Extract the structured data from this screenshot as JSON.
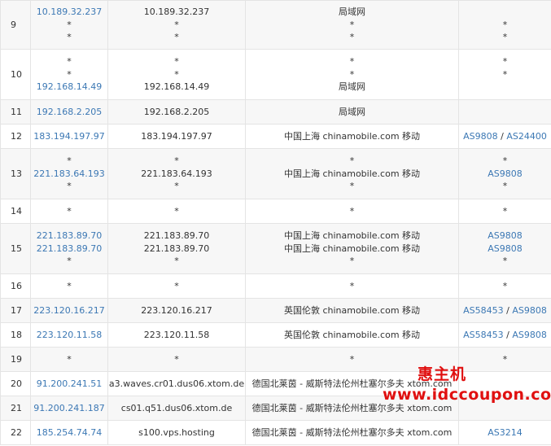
{
  "rows": [
    {
      "hop": "9",
      "h": 60,
      "ip": [
        {
          "t": "10.189.32.237",
          "link": true
        },
        {
          "t": "*"
        },
        {
          "t": "*"
        }
      ],
      "host": [
        "10.189.32.237",
        "*",
        "*"
      ],
      "loc": [
        "局域网",
        "*",
        "*"
      ],
      "as": [
        [],
        [
          "*"
        ],
        [
          "*"
        ]
      ]
    },
    {
      "hop": "10",
      "h": 62,
      "ip": [
        {
          "t": "*"
        },
        {
          "t": "*"
        },
        {
          "t": "192.168.14.49",
          "link": true
        }
      ],
      "host": [
        "*",
        "*",
        "192.168.14.49"
      ],
      "loc": [
        "*",
        "*",
        "局域网"
      ],
      "as": [
        [
          "*"
        ],
        [
          "*"
        ],
        []
      ]
    },
    {
      "hop": "11",
      "h": 30,
      "ip": [
        {
          "t": "192.168.2.205",
          "link": true
        }
      ],
      "host": [
        "192.168.2.205"
      ],
      "loc": [
        "局域网"
      ],
      "as": [
        []
      ]
    },
    {
      "hop": "12",
      "h": 30,
      "ip": [
        {
          "t": "183.194.197.97",
          "link": true
        }
      ],
      "host": [
        "183.194.197.97"
      ],
      "loc": [
        "中国上海 chinamobile.com 移动"
      ],
      "as": [
        [
          "AS9808",
          "AS24400"
        ]
      ]
    },
    {
      "hop": "13",
      "h": 62,
      "ip": [
        {
          "t": "*"
        },
        {
          "t": "221.183.64.193",
          "link": true
        },
        {
          "t": "*"
        }
      ],
      "host": [
        "*",
        "221.183.64.193",
        "*"
      ],
      "loc": [
        "*",
        "中国上海 chinamobile.com 移动",
        "*"
      ],
      "as": [
        [
          "*"
        ],
        [
          "AS9808"
        ],
        [
          "*"
        ]
      ]
    },
    {
      "hop": "14",
      "h": 30,
      "ip": [
        {
          "t": "*"
        }
      ],
      "host": [
        "*"
      ],
      "loc": [
        "*"
      ],
      "as": [
        [
          "*"
        ]
      ]
    },
    {
      "hop": "15",
      "h": 62,
      "ip": [
        {
          "t": "221.183.89.70",
          "link": true
        },
        {
          "t": "221.183.89.70",
          "link": true
        },
        {
          "t": "*"
        }
      ],
      "host": [
        "221.183.89.70",
        "221.183.89.70",
        "*"
      ],
      "loc": [
        "中国上海 chinamobile.com 移动",
        "中国上海 chinamobile.com 移动",
        "*"
      ],
      "as": [
        [
          "AS9808"
        ],
        [
          "AS9808"
        ],
        [
          "*"
        ]
      ]
    },
    {
      "hop": "16",
      "h": 30,
      "ip": [
        {
          "t": "*"
        }
      ],
      "host": [
        "*"
      ],
      "loc": [
        "*"
      ],
      "as": [
        [
          "*"
        ]
      ]
    },
    {
      "hop": "17",
      "h": 30,
      "ip": [
        {
          "t": "223.120.16.217",
          "link": true
        }
      ],
      "host": [
        "223.120.16.217"
      ],
      "loc": [
        "英国伦敦 chinamobile.com 移动"
      ],
      "as": [
        [
          "AS58453",
          "AS9808"
        ]
      ]
    },
    {
      "hop": "18",
      "h": 30,
      "ip": [
        {
          "t": "223.120.11.58",
          "link": true
        }
      ],
      "host": [
        "223.120.11.58"
      ],
      "loc": [
        "英国伦敦 chinamobile.com 移动"
      ],
      "as": [
        [
          "AS58453",
          "AS9808"
        ]
      ]
    },
    {
      "hop": "19",
      "h": 30,
      "ip": [
        {
          "t": "*"
        }
      ],
      "host": [
        "*"
      ],
      "loc": [
        "*"
      ],
      "as": [
        [
          "*"
        ]
      ]
    },
    {
      "hop": "20",
      "h": 30,
      "ip": [
        {
          "t": "91.200.241.51",
          "link": true
        }
      ],
      "host": [
        "a3.waves.cr01.dus06.xtom.de"
      ],
      "loc": [
        "德国北莱茵 - 威斯特法伦州杜塞尔多夫 xtom.com"
      ],
      "as": [
        []
      ]
    },
    {
      "hop": "21",
      "h": 30,
      "ip": [
        {
          "t": "91.200.241.187",
          "link": true
        }
      ],
      "host": [
        "cs01.q51.dus06.xtom.de"
      ],
      "loc": [
        "德国北莱茵 - 威斯特法伦州杜塞尔多夫 xtom.com"
      ],
      "as": [
        []
      ]
    },
    {
      "hop": "22",
      "h": 30,
      "ip": [
        {
          "t": "185.254.74.74",
          "link": true
        }
      ],
      "host": [
        "s100.vps.hosting"
      ],
      "loc": [
        "德国北莱茵 - 威斯特法伦州杜塞尔多夫 xtom.com"
      ],
      "as": [
        [
          "AS3214"
        ]
      ]
    }
  ],
  "watermark": {
    "line1": "惠主机",
    "line2": "www.idccoupon.com",
    "color": "#e01010"
  },
  "colors": {
    "link": "#3c78b4",
    "stripe": "#f7f7f7",
    "border": "#e4e4e4"
  }
}
